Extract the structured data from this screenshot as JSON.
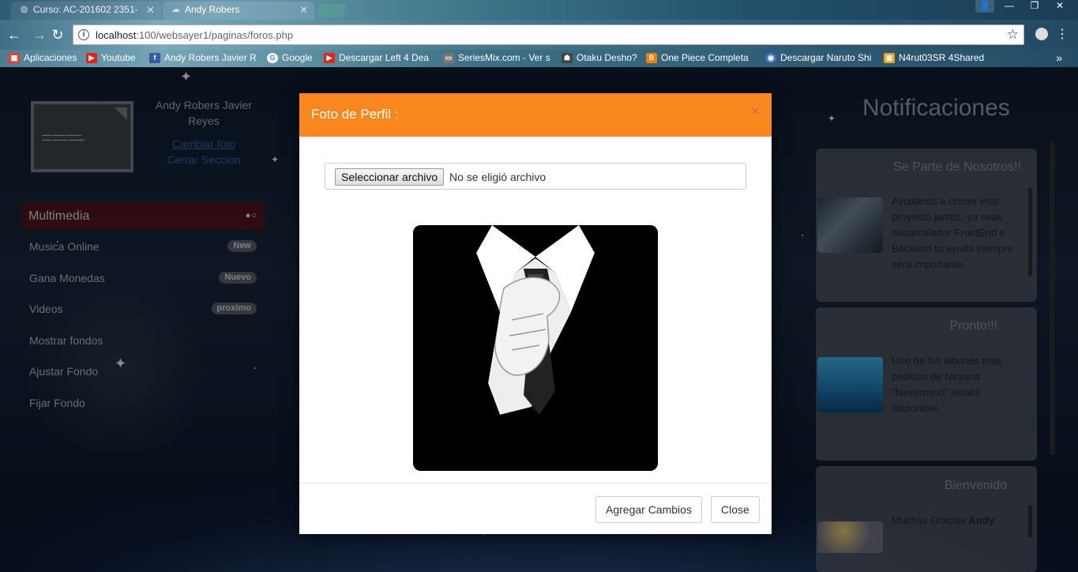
{
  "browser": {
    "tabs": [
      {
        "title": "Curso: AC-201602 2351-",
        "icon": "moodle-icon"
      },
      {
        "title": "Andy Robers",
        "icon": "cloud-icon"
      }
    ],
    "url_host": "localhost",
    "url_path": ":100/websayer1/paginas/foros.php",
    "bookmarks": [
      {
        "label": "Aplicaciones",
        "icon": "apps-grid-icon",
        "color": "#e94235"
      },
      {
        "label": "Youtube",
        "icon": "youtube-icon",
        "color": "#e62117"
      },
      {
        "label": "Andy Robers Javier Re",
        "icon": "facebook-icon",
        "color": "#3b5998"
      },
      {
        "label": "Google",
        "icon": "google-icon",
        "color": "#4285f4"
      },
      {
        "label": "Descargar Left 4 Dea",
        "icon": "youtube-icon",
        "color": "#e62117"
      },
      {
        "label": "SeriesMix.com - Ver s",
        "icon": "tv-icon",
        "color": "#777777"
      },
      {
        "label": "Otaku Desho?",
        "icon": "otaku-icon",
        "color": "#444444"
      },
      {
        "label": "One Piece Completa",
        "icon": "blogger-icon",
        "color": "#f57d00"
      },
      {
        "label": "Descargar Naruto Shi",
        "icon": "globe-icon",
        "color": "#4a6fd6"
      },
      {
        "label": "N4rut03SR 4Shared",
        "icon": "4shared-icon",
        "color": "#f0a020"
      }
    ]
  },
  "sidebar": {
    "user_name": "Andy Robers Javier Reyes",
    "change_photo": "Cambiar foto",
    "logout": "Cerrar Seccion",
    "menu_header": "Multimedia",
    "items": [
      {
        "label": "Musica Online",
        "badge": "New"
      },
      {
        "label": "Gana Monedas",
        "badge": "Nuevo"
      },
      {
        "label": "Videos",
        "badge": "proximo"
      },
      {
        "label": "Mostrar fondos",
        "badge": ""
      },
      {
        "label": "Ajustar Fondo",
        "badge": ""
      },
      {
        "label": "Fijar Fondo",
        "badge": ""
      }
    ]
  },
  "notifications": {
    "title": "Notificaciones",
    "cards": [
      {
        "title": "Se Parte de Nosotros!!",
        "text": "Ayudanos a crecer este proyecto juntos, ya seas desarrollador FrontEnd o Backend tu ayuda siempre sera importante."
      },
      {
        "title": "Pronto!!!",
        "text": "Uno de los albunes mas pedidos de Nirvana \"Nevermind\" estara disponible."
      },
      {
        "title": "Bienvenido",
        "text_prefix": "Muchas Gracias",
        "text_bold": "Andy"
      }
    ]
  },
  "modal": {
    "title": "Foto de Perfil :",
    "close_symbol": "×",
    "file_button": "Seleccionar archivo",
    "file_status": "No se eligió archivo",
    "primary_button": "Agregar Cambios",
    "close_button": "Close",
    "header_color": "#fa861e"
  }
}
